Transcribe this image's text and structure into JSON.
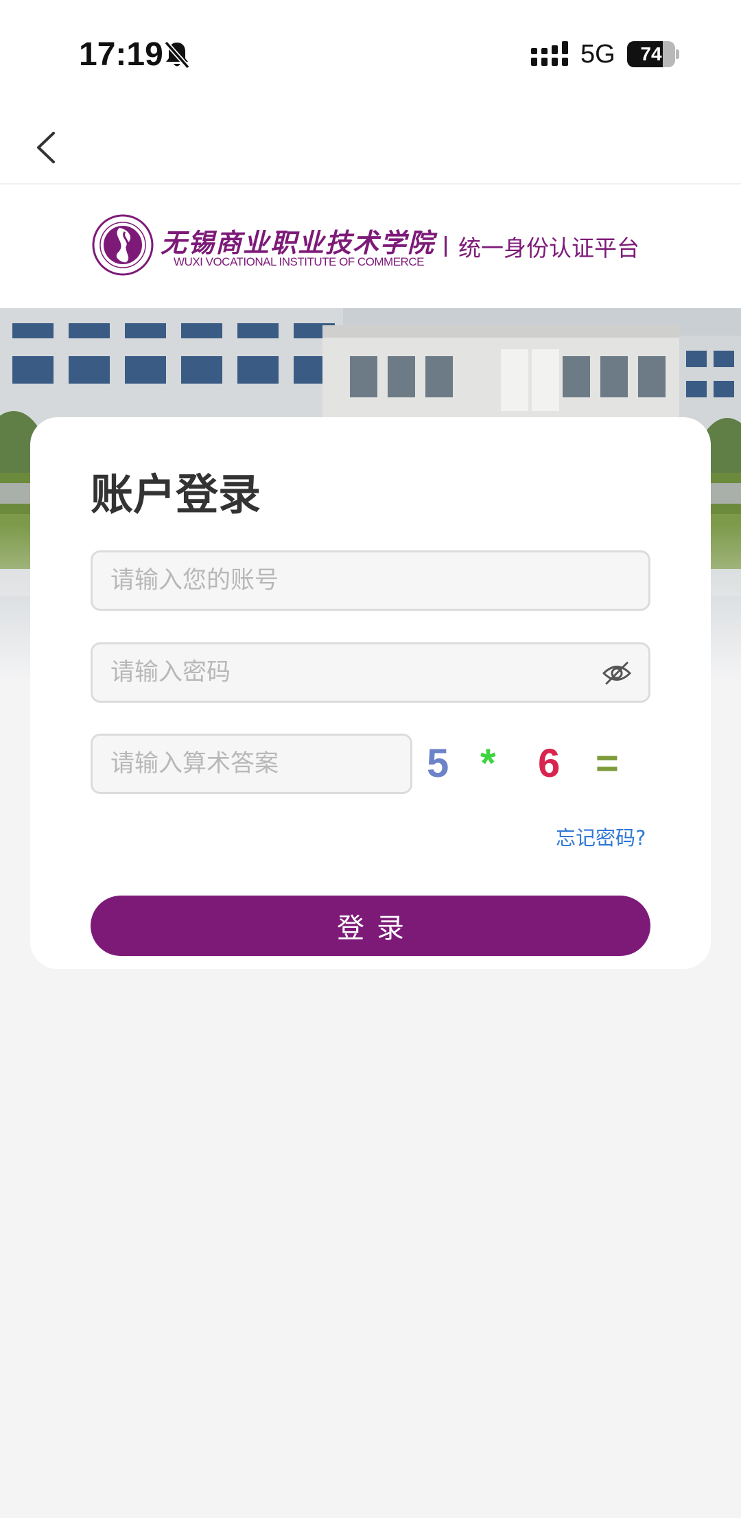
{
  "status_bar": {
    "time": "17:19",
    "network": "5G",
    "battery_level": "74",
    "battery_fraction": 0.74,
    "icons": [
      "bell-muted-icon",
      "signal-icon",
      "battery-icon"
    ]
  },
  "nav": {
    "back_icon": "chevron-left-icon"
  },
  "header": {
    "school_name_cn": "无锡商业职业技术学院",
    "school_name_en": "WUXI VOCATIONAL INSTITUTE OF COMMERCE",
    "platform_name": "统一身份认证平台",
    "brand_color": "#7d1a78"
  },
  "login": {
    "title": "账户登录",
    "account_placeholder": "请输入您的账号",
    "account_value": "",
    "password_placeholder": "请输入密码",
    "password_value": "",
    "captcha_placeholder": "请输入算术答案",
    "captcha_value": "",
    "captcha": {
      "chars": [
        "5",
        "*",
        "6",
        "="
      ],
      "colors": [
        "#6c83c9",
        "#3dd43d",
        "#d8244f",
        "#7d9b3a"
      ]
    },
    "forgot_label": "忘记密码?",
    "submit_label": "登录",
    "link_color": "#2f78d6",
    "button_color": "#7d1a78"
  }
}
